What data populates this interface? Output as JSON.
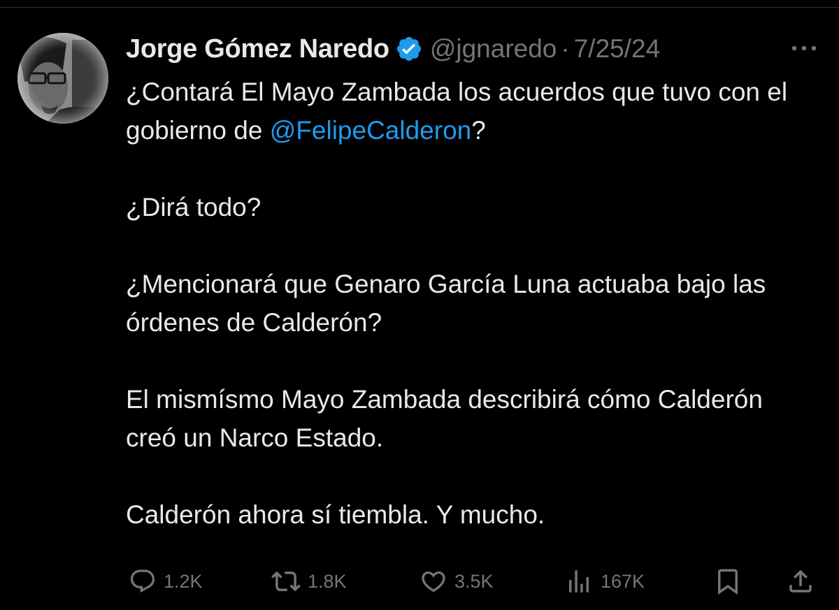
{
  "tweet": {
    "author": {
      "display_name": "Jorge Gómez Naredo",
      "handle": "@jgnaredo",
      "verified": true,
      "avatar_icon": "profile-photo"
    },
    "separator": "·",
    "date": "7/25/24",
    "body": {
      "p1_before": "¿Contará El Mayo Zambada los acuerdos que tuvo con el gobierno de ",
      "p1_mention": "@FelipeCalderon",
      "p1_after": "?",
      "p2": "¿Dirá todo?",
      "p3": "¿Mencionará que Genaro García Luna actuaba bajo las órdenes de Calderón?",
      "p4": "El mismísmo Mayo Zambada describirá cómo Calderón creó un Narco Estado.",
      "p5": "Calderón ahora sí tiembla. Y mucho."
    },
    "metrics": {
      "replies": "1.2K",
      "reposts": "1.8K",
      "likes": "3.5K",
      "views": "167K"
    }
  },
  "colors": {
    "background": "#000000",
    "text": "#e7e9ea",
    "secondary_text": "#71767b",
    "link": "#1d9bf0",
    "verified_badge": "#1d9bf0"
  },
  "icons": {
    "more": "more-dots-icon",
    "reply": "reply-bubble-icon",
    "repost": "repost-arrows-icon",
    "like": "heart-icon",
    "views": "bar-chart-icon",
    "bookmark": "bookmark-icon",
    "share": "share-upload-icon"
  }
}
